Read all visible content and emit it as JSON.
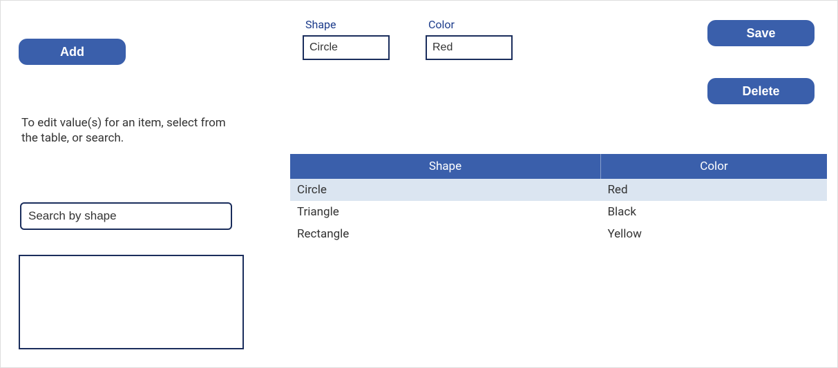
{
  "buttons": {
    "add": "Add",
    "save": "Save",
    "delete": "Delete"
  },
  "fields": {
    "shape": {
      "label": "Shape",
      "value": "Circle"
    },
    "color": {
      "label": "Color",
      "value": "Red"
    }
  },
  "help_text": "To edit value(s) for an item, select from the table, or search.",
  "search": {
    "placeholder": "Search by shape"
  },
  "table": {
    "headers": [
      "Shape",
      "Color"
    ],
    "rows": [
      {
        "shape": "Circle",
        "color": "Red",
        "selected": true
      },
      {
        "shape": "Triangle",
        "color": "Black",
        "selected": false
      },
      {
        "shape": "Rectangle",
        "color": "Yellow",
        "selected": false
      }
    ]
  }
}
